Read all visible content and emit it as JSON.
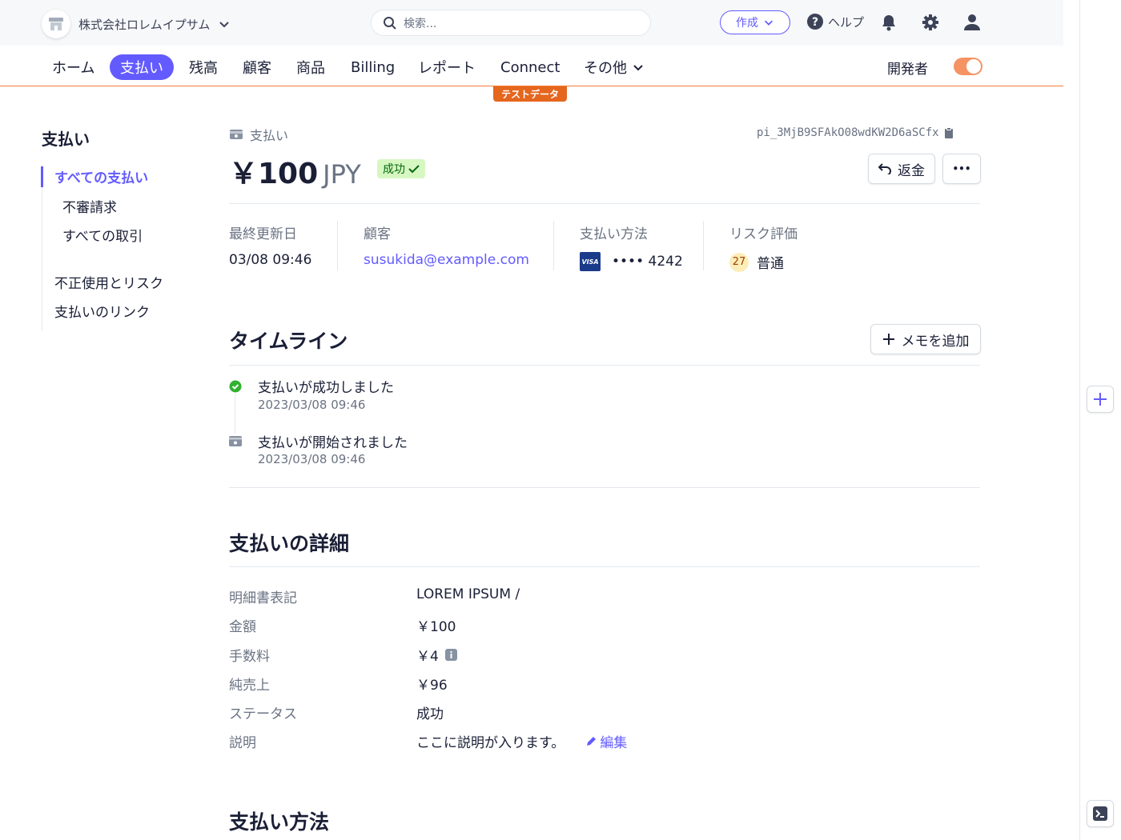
{
  "topbar": {
    "account_name": "株式会社ロレムイプサム",
    "search_placeholder": "検索...",
    "create_label": "作成",
    "help_label": "ヘルプ"
  },
  "nav": {
    "items": [
      "ホーム",
      "支払い",
      "残高",
      "顧客",
      "商品",
      "Billing",
      "レポート",
      "Connect",
      "その他"
    ],
    "active": "支払い",
    "developer_label": "開発者",
    "test_badge": "テストデータ"
  },
  "sidebar": {
    "title": "支払い",
    "items": [
      "すべての支払い",
      "不審請求",
      "すべての取引",
      "不正使用とリスク",
      "支払いのリンク"
    ]
  },
  "payment": {
    "breadcrumb": "支払い",
    "id": "pi_3MjB9SFAkO08wdKW2D6aSCfx",
    "amount": "￥100",
    "currency": "JPY",
    "status_badge": "成功",
    "refund_label": "返金",
    "more_label": "•••",
    "summary": {
      "updated_label": "最終更新日",
      "updated_value": "03/08 09:46",
      "customer_label": "顧客",
      "customer_value": "susukida@example.com",
      "method_label": "支払い方法",
      "card_brand": "VISA",
      "card_last4": "•••• 4242",
      "risk_label": "リスク評価",
      "risk_score": "27",
      "risk_level": "普通"
    }
  },
  "timeline": {
    "title": "タイムライン",
    "add_note_label": "メモを追加",
    "events": [
      {
        "title": "支払いが成功しました",
        "time": "2023/03/08 09:46"
      },
      {
        "title": "支払いが開始されました",
        "time": "2023/03/08 09:46"
      }
    ]
  },
  "details": {
    "title": "支払いの詳細",
    "rows": [
      {
        "label": "明細書表記",
        "value": "LOREM IPSUM /"
      },
      {
        "label": "金額",
        "value": "￥100"
      },
      {
        "label": "手数料",
        "value": "￥4"
      },
      {
        "label": "純売上",
        "value": "￥96"
      },
      {
        "label": "ステータス",
        "value": "成功"
      },
      {
        "label": "説明",
        "value": "ここに説明が入ります。"
      }
    ],
    "edit_label": "編集"
  },
  "payment_method_section": {
    "title": "支払い方法"
  },
  "colors": {
    "accent": "#635bff",
    "test_orange": "#e5661d",
    "success_bg": "#d7f7c2",
    "success_fg": "#05690d"
  }
}
